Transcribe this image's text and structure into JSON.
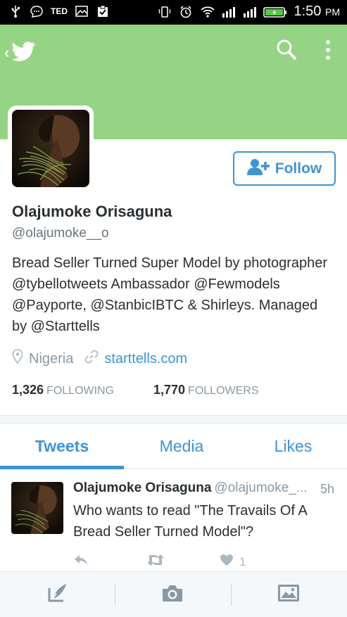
{
  "status_bar": {
    "carrier_badge": "TED",
    "time": "1:50",
    "ampm": "PM"
  },
  "header": {
    "brand_color": "#95d484",
    "accent_color": "#3b94d9",
    "icons": [
      "back-chevron-icon",
      "twitter-bird-icon",
      "search-icon",
      "more-vertical-icon"
    ]
  },
  "profile": {
    "name": "Olajumoke Orisaguna",
    "handle": "@olajumoke__o",
    "follow_label": "Follow",
    "bio": "Bread Seller Turned Super Model by photographer @tybellotweets Ambassador @Fewmodels @Payporte, @StanbicIBTC & Shirleys. Managed by @Starttells",
    "location": "Nigeria",
    "website": "starttells.com",
    "following_count": "1,326",
    "following_label": "FOLLOWING",
    "followers_count": "1,770",
    "followers_label": "FOLLOWERS"
  },
  "tabs": [
    {
      "label": "Tweets",
      "active": true
    },
    {
      "label": "Media",
      "active": false
    },
    {
      "label": "Likes",
      "active": false
    }
  ],
  "tweet": {
    "author_name": "Olajumoke Orisaguna",
    "author_handle": "@olajumoke_...",
    "time": "5h",
    "text": "Who wants to read \"The Travails Of A Bread Seller Turned Model\"?",
    "like_count": "1"
  },
  "bottom_bar": {
    "icons": [
      "compose-icon",
      "camera-icon",
      "image-icon"
    ]
  }
}
